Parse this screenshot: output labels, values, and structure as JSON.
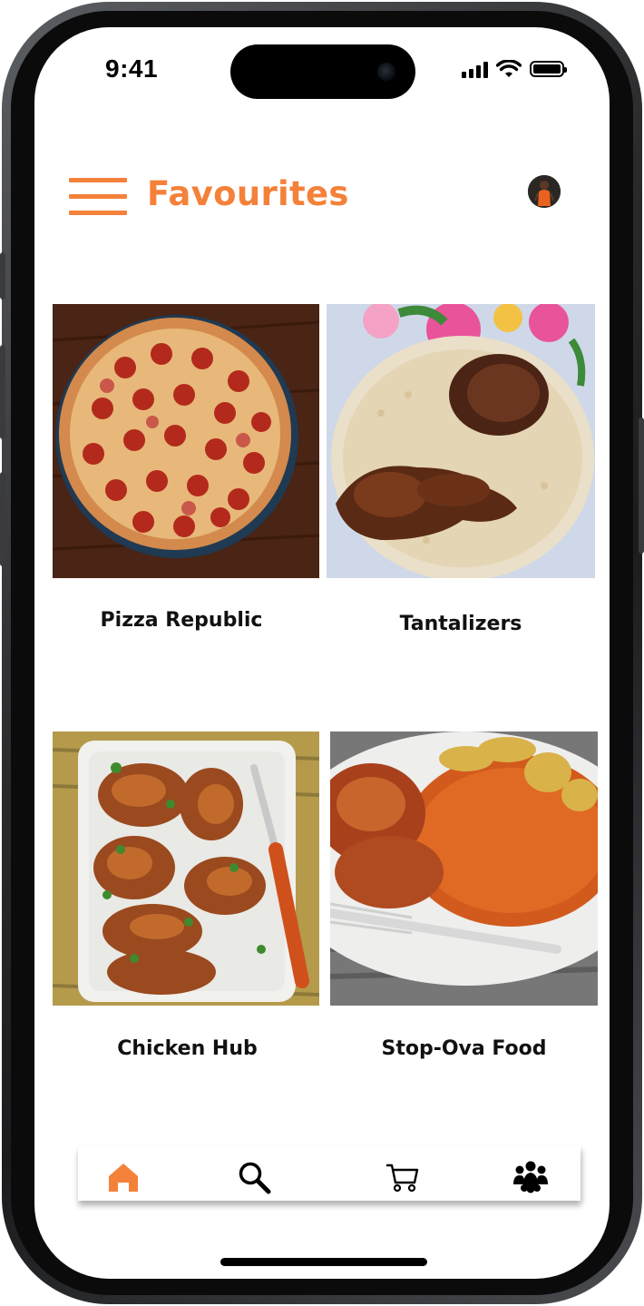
{
  "status_bar": {
    "time": "9:41"
  },
  "header": {
    "title": "Favourites",
    "menu_icon": "hamburger-menu-icon",
    "avatar_icon": "profile-avatar"
  },
  "favourites": [
    {
      "name": "Pizza Republic",
      "image": "pepperoni-pizza-photo"
    },
    {
      "name": "Tantalizers",
      "image": "fried-rice-chicken-photo"
    },
    {
      "name": "Chicken Hub",
      "image": "grilled-chicken-photo"
    },
    {
      "name": "Stop-Ova Food",
      "image": "jollof-rice-plantain-photo"
    }
  ],
  "bottom_nav": [
    {
      "icon": "home-icon",
      "active": true
    },
    {
      "icon": "search-icon",
      "active": false
    },
    {
      "icon": "cart-icon",
      "active": false
    },
    {
      "icon": "community-icon",
      "active": false
    }
  ],
  "colors": {
    "accent": "#f4813a",
    "text": "#111111",
    "background": "#ffffff"
  }
}
